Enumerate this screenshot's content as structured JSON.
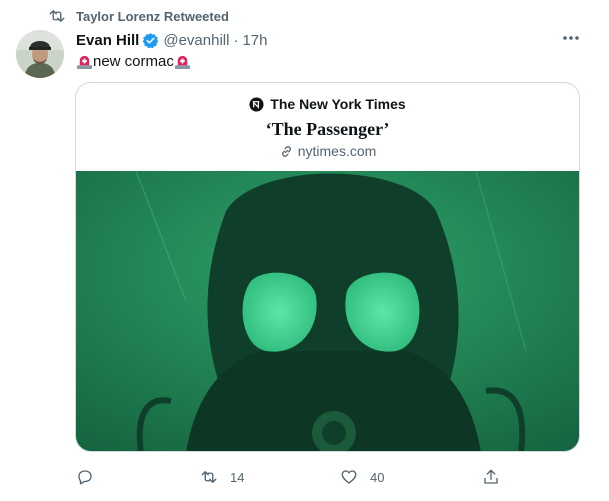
{
  "retweet_context": {
    "text": "Taylor Lorenz Retweeted"
  },
  "author": {
    "name": "Evan Hill",
    "handle": "@evanhill",
    "separator": "·",
    "time": "17h"
  },
  "tweet": {
    "text": "new cormac"
  },
  "card": {
    "source": "The New York Times",
    "title": "‘The Passenger’",
    "domain": "nytimes.com"
  },
  "actions": {
    "retweet_count": "14",
    "like_count": "40"
  },
  "icons": {
    "retweet": "retweet-icon",
    "verified": "verified-badge-icon",
    "more": "more-icon",
    "siren": "siren-emoji-icon",
    "nyt": "nyt-logo-icon",
    "link": "link-icon",
    "reply": "reply-icon",
    "like": "heart-icon",
    "share": "share-icon"
  },
  "colors": {
    "verified": "#1d9bf0",
    "secondary_text": "#536471",
    "card_image_bg": "#1f8c5a"
  }
}
